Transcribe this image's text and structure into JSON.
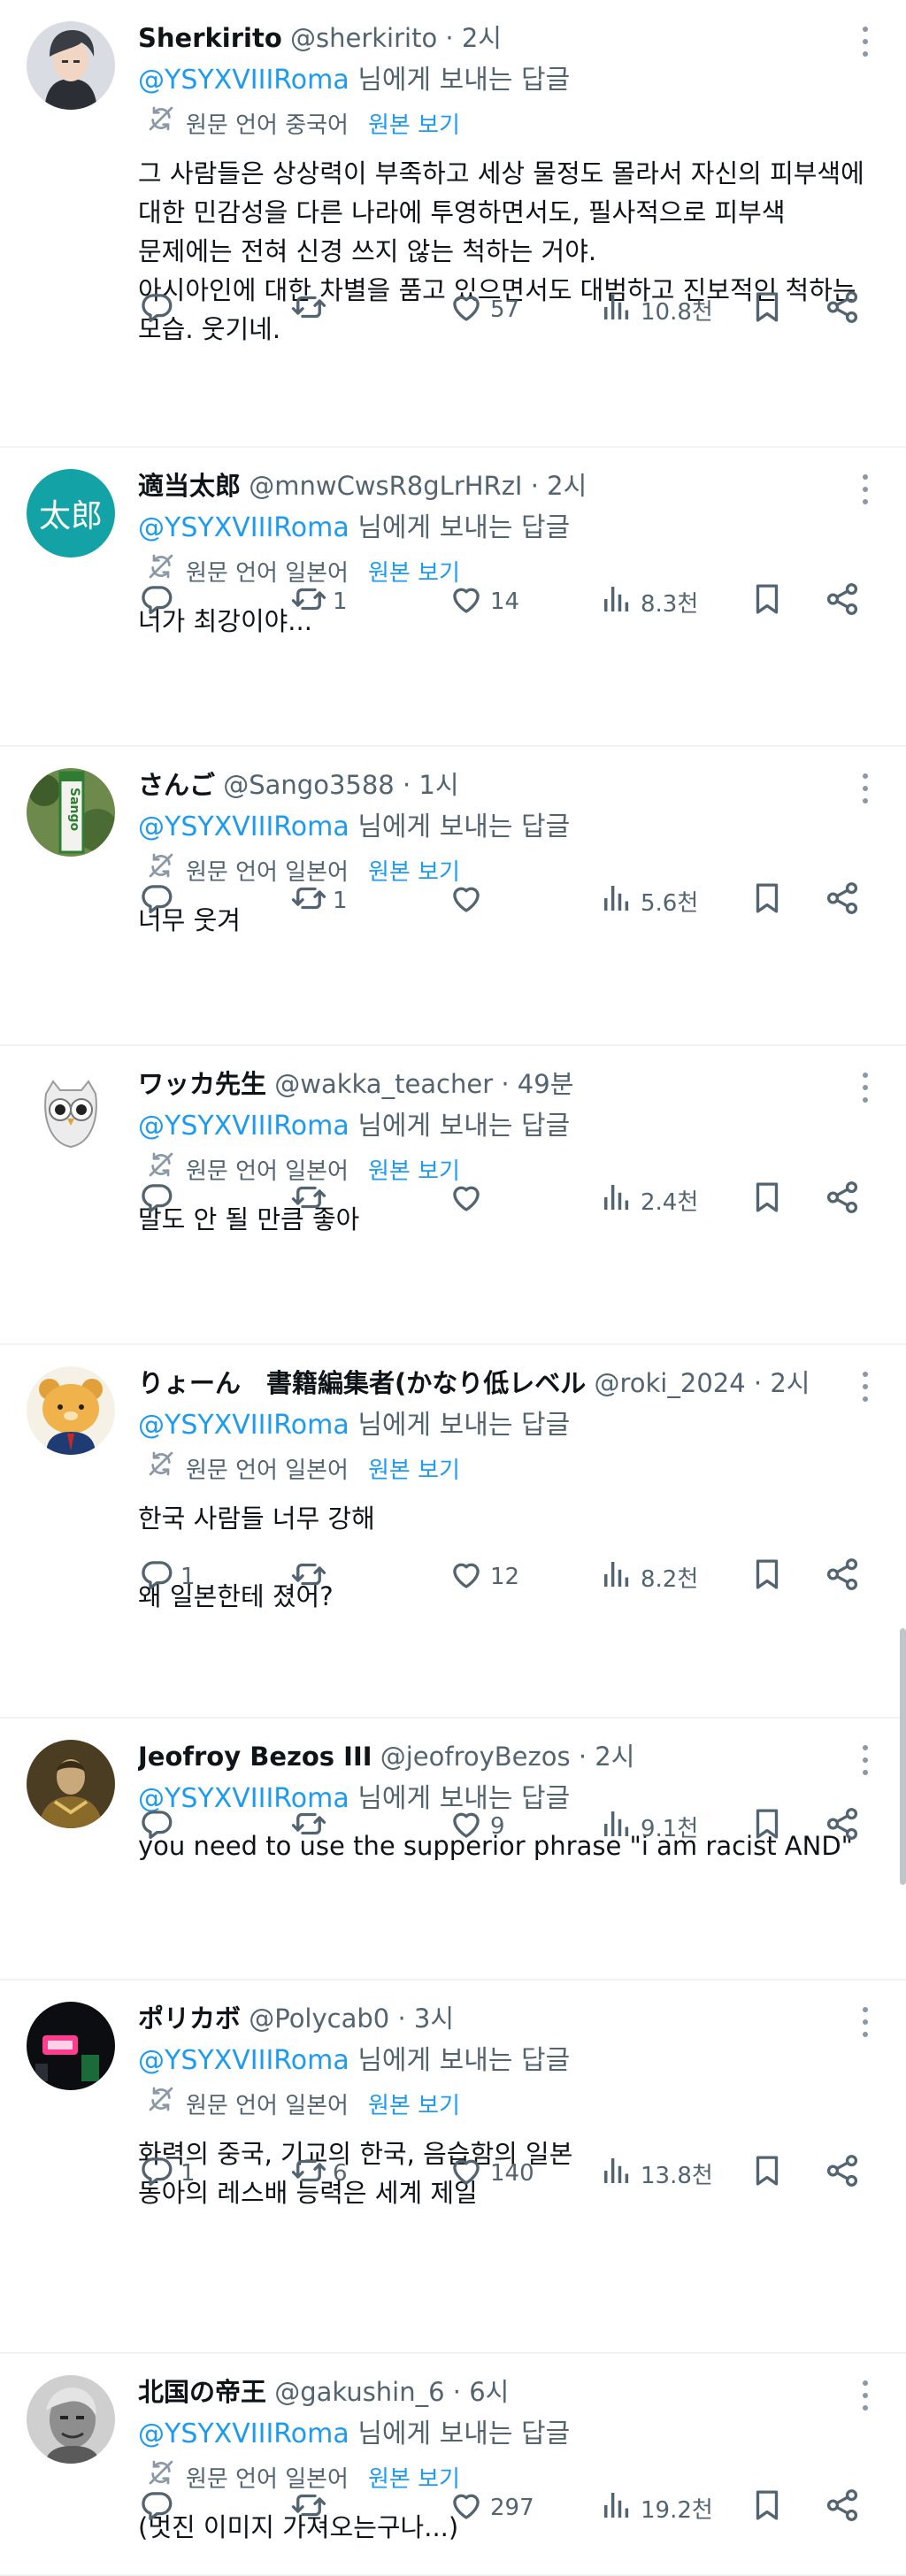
{
  "translate_label": "원문 언어",
  "show_original": "원본 보기",
  "reply_suffix": "님에게 보내는 답글",
  "tweets": [
    {
      "name": "Sherkirito",
      "handle": "@sherkirito",
      "time": "· 2시",
      "mention": "@YSYXVIIIRoma",
      "source_lang": "중국어",
      "text": "그 사람들은 상상력이 부족하고 세상 물정도 몰라서 자신의 피부색에\n대한 민감성을 다른 나라에 투영하면서도, 필사적으로 피부색\n문제에는 전혀 신경 쓰지 않는 척하는 거야.\n아시아인에 대한 차별을 품고 있으면서도 대범하고 진보적인 척하는\n모습. 웃기네.",
      "replies": "",
      "retweets": "",
      "likes": "57",
      "views": "10.8천",
      "avatar": "anime-man-avatar"
    },
    {
      "name": "適当太郎",
      "handle": "@mnwCwsR8gLrHRzI",
      "time": "· 2시",
      "mention": "@YSYXVIIIRoma",
      "source_lang": "일본어",
      "text": "너가 최강이야...",
      "replies": "",
      "retweets": "1",
      "likes": "14",
      "views": "8.3천",
      "avatar": "taro-avatar",
      "avatar_text": "太郎"
    },
    {
      "name": "さんご",
      "handle": "@Sango3588",
      "time": "· 1시",
      "mention": "@YSYXVIIIRoma",
      "source_lang": "일본어",
      "text": "너무 웃겨",
      "replies": "",
      "retweets": "1",
      "likes": "",
      "views": "5.6천",
      "avatar": "station-sign-avatar",
      "avatar_text": "Sango"
    },
    {
      "name": "ワッカ先生",
      "handle": "@wakka_teacher",
      "time": "· 49분",
      "mention": "@YSYXVIIIRoma",
      "source_lang": "일본어",
      "text": "말도 안 될 만큼 좋아",
      "replies": "",
      "retweets": "",
      "likes": "",
      "views": "2.4천",
      "avatar": "owl-avatar"
    },
    {
      "name": "りょーん　書籍編集者(かなり低レベル",
      "handle": "@roki_2024",
      "time": "· 2시",
      "mention": "@YSYXVIIIRoma",
      "source_lang": "일본어",
      "text": "한국 사람들 너무 강해\n\n왜 일본한테 졌어?",
      "replies": "1",
      "retweets": "",
      "likes": "12",
      "views": "8.2천",
      "avatar": "bear-avatar"
    },
    {
      "name": "Jeofroy Bezos III",
      "handle": "@jeofroyBezos",
      "time": "· 2시",
      "mention": "@YSYXVIIIRoma",
      "source_lang": "",
      "text": "you need to use the supperior phrase \"i am racist AND\"",
      "replies": "",
      "retweets": "",
      "likes": "9",
      "views": "9.1천",
      "avatar": "portrait-painting-avatar"
    },
    {
      "name": "ポリカボ",
      "handle": "@Polycab0",
      "time": "· 3시",
      "mention": "@YSYXVIIIRoma",
      "source_lang": "일본어",
      "text": "화력의 중국, 기교의 한국, 음습함의 일본\n동아의 레스배 능력은 세계 제일",
      "replies": "1",
      "retweets": "6",
      "likes": "140",
      "views": "13.8천",
      "avatar": "neon-sign-avatar"
    },
    {
      "name": "北国の帝王",
      "handle": "@gakushin_6",
      "time": "· 6시",
      "mention": "@YSYXVIIIRoma",
      "source_lang": "일본어",
      "text": "(멋진 이미지 가져오는구나...)",
      "replies": "",
      "retweets": "",
      "likes": "297",
      "views": "19.2천",
      "avatar": "old-man-photo-avatar"
    }
  ]
}
